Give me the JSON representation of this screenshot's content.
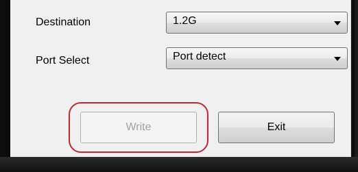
{
  "form": {
    "destination": {
      "label": "Destination",
      "value": "1.2G"
    },
    "port_select": {
      "label": "Port Select",
      "value": "Port detect"
    }
  },
  "buttons": {
    "write_label": "Write",
    "write_enabled": false,
    "exit_label": "Exit"
  },
  "icons": {
    "dropdown": "chevron-down-icon"
  },
  "colors": {
    "highlight": "#c4262e",
    "disabled_text": "#a0a0a0"
  }
}
